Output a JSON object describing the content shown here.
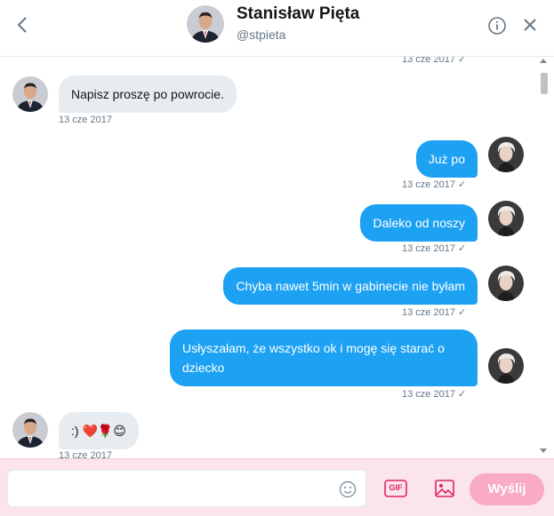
{
  "header": {
    "title": "Stanisław Pięta",
    "handle": "@stpieta",
    "back_icon": "chevron-left-icon",
    "info_icon": "info-icon",
    "close_icon": "close-icon"
  },
  "messages": [
    {
      "direction": "out",
      "text": "",
      "time": "13 cze 2017",
      "check": "✓",
      "partial": true
    },
    {
      "direction": "in",
      "text": "Napisz proszę  po powrocie.",
      "time": "13 cze 2017"
    },
    {
      "direction": "out",
      "text": "Już po",
      "time": "13 cze 2017",
      "check": "✓"
    },
    {
      "direction": "out",
      "text": "Daleko od noszy",
      "time": "13 cze 2017",
      "check": "✓"
    },
    {
      "direction": "out",
      "text": "Chyba nawet 5min w gabinecie nie byłam",
      "time": "13 cze 2017",
      "check": "✓"
    },
    {
      "direction": "out",
      "text": "Usłyszałam, że wszystko ok i mogę się starać o dziecko",
      "time": "13 cze 2017",
      "check": "✓"
    },
    {
      "direction": "in",
      "text": ":) ❤️🌹😊",
      "time": "13 cze 2017"
    }
  ],
  "composer": {
    "placeholder": "",
    "send_label": "Wyślij",
    "gif_label": "GIF",
    "emoji_icon": "emoji-icon",
    "image_icon": "image-icon"
  },
  "colors": {
    "accent": "#1da1f2",
    "incoming_bubble": "#e6ecf0",
    "composer_bg": "#fce4ec",
    "send_button": "#f8aac6"
  }
}
